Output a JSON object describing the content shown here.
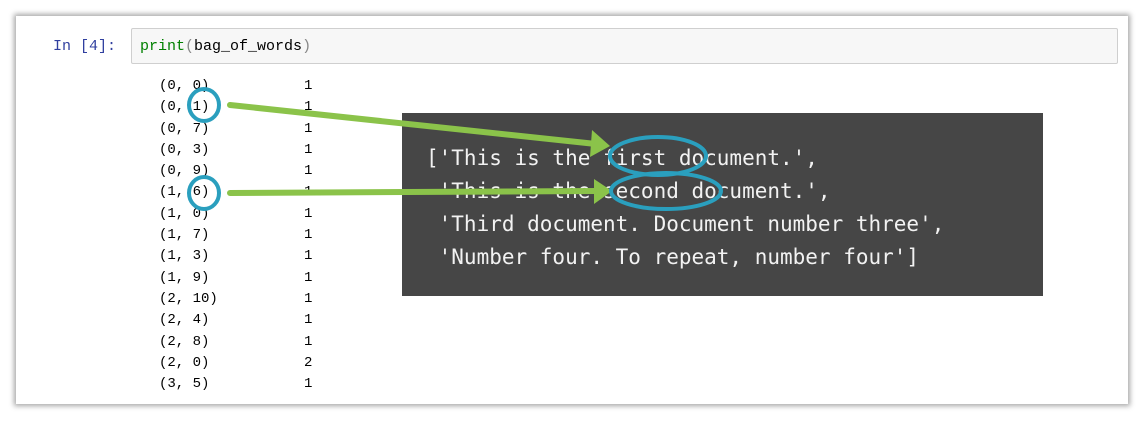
{
  "cell": {
    "prompt": "In [4]:",
    "code_func": "print",
    "code_open": "(",
    "code_arg": "bag_of_words",
    "code_close": ")"
  },
  "output_rows": [
    {
      "key": "(0, 0)",
      "val": "1"
    },
    {
      "key": "(0, 1)",
      "val": "1"
    },
    {
      "key": "(0, 7)",
      "val": "1"
    },
    {
      "key": "(0, 3)",
      "val": "1"
    },
    {
      "key": "(0, 9)",
      "val": "1"
    },
    {
      "key": "(1, 6)",
      "val": "1"
    },
    {
      "key": "(1, 0)",
      "val": "1"
    },
    {
      "key": "(1, 7)",
      "val": "1"
    },
    {
      "key": "(1, 3)",
      "val": "1"
    },
    {
      "key": "(1, 9)",
      "val": "1"
    },
    {
      "key": "(2, 10)",
      "val": "1"
    },
    {
      "key": "(2, 4)",
      "val": "1"
    },
    {
      "key": "(2, 8)",
      "val": "1"
    },
    {
      "key": "(2, 0)",
      "val": "2"
    },
    {
      "key": "(3, 5)",
      "val": "1"
    }
  ],
  "documents": [
    "['This is the first document.',",
    " 'This is the second document.',",
    " 'Third document. Document number three',",
    " 'Number four. To repeat, number four']"
  ],
  "colors": {
    "arrow": "#8bc34a",
    "circle": "#2a9fbe",
    "overlay_bg": "#464646",
    "prompt": "#303f9f"
  }
}
